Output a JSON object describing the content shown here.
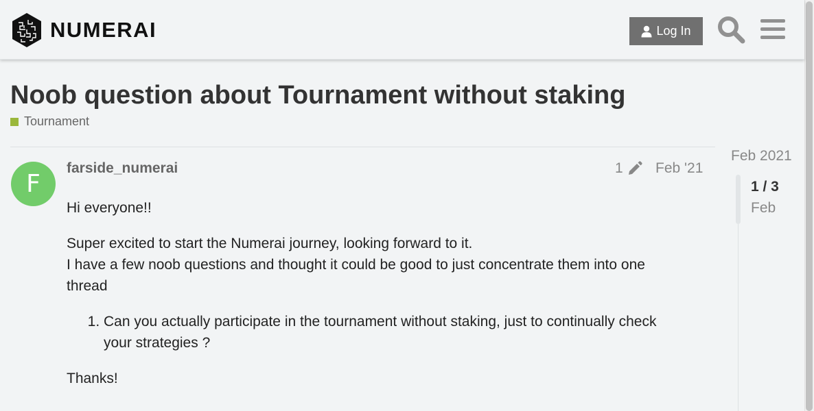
{
  "header": {
    "logo_text": "NUMERAI",
    "login_label": "Log In",
    "icons": {
      "user": "user-icon",
      "search": "search-icon",
      "menu": "hamburger-menu-icon"
    }
  },
  "topic": {
    "title": "Noob question about Tournament without staking",
    "category": {
      "label": "Tournament",
      "color": "#9ab73b"
    }
  },
  "post": {
    "avatar_letter": "F",
    "avatar_color": "#72cc6a",
    "username": "farside_numerai",
    "edit_count": "1",
    "date": "Feb '21",
    "paragraphs": [
      "Hi everyone!!",
      "Super excited to start the Numerai journey, looking forward to it.",
      "I have a few noob questions and thought it could be good to just concentrate them into one thread"
    ],
    "list_items": [
      "Can you actually participate in the tournament without staking, just to continually check your strategies ?"
    ],
    "closing": "Thanks!"
  },
  "timeline": {
    "start_date": "Feb 2021",
    "position": "1 / 3",
    "month": "Feb"
  }
}
